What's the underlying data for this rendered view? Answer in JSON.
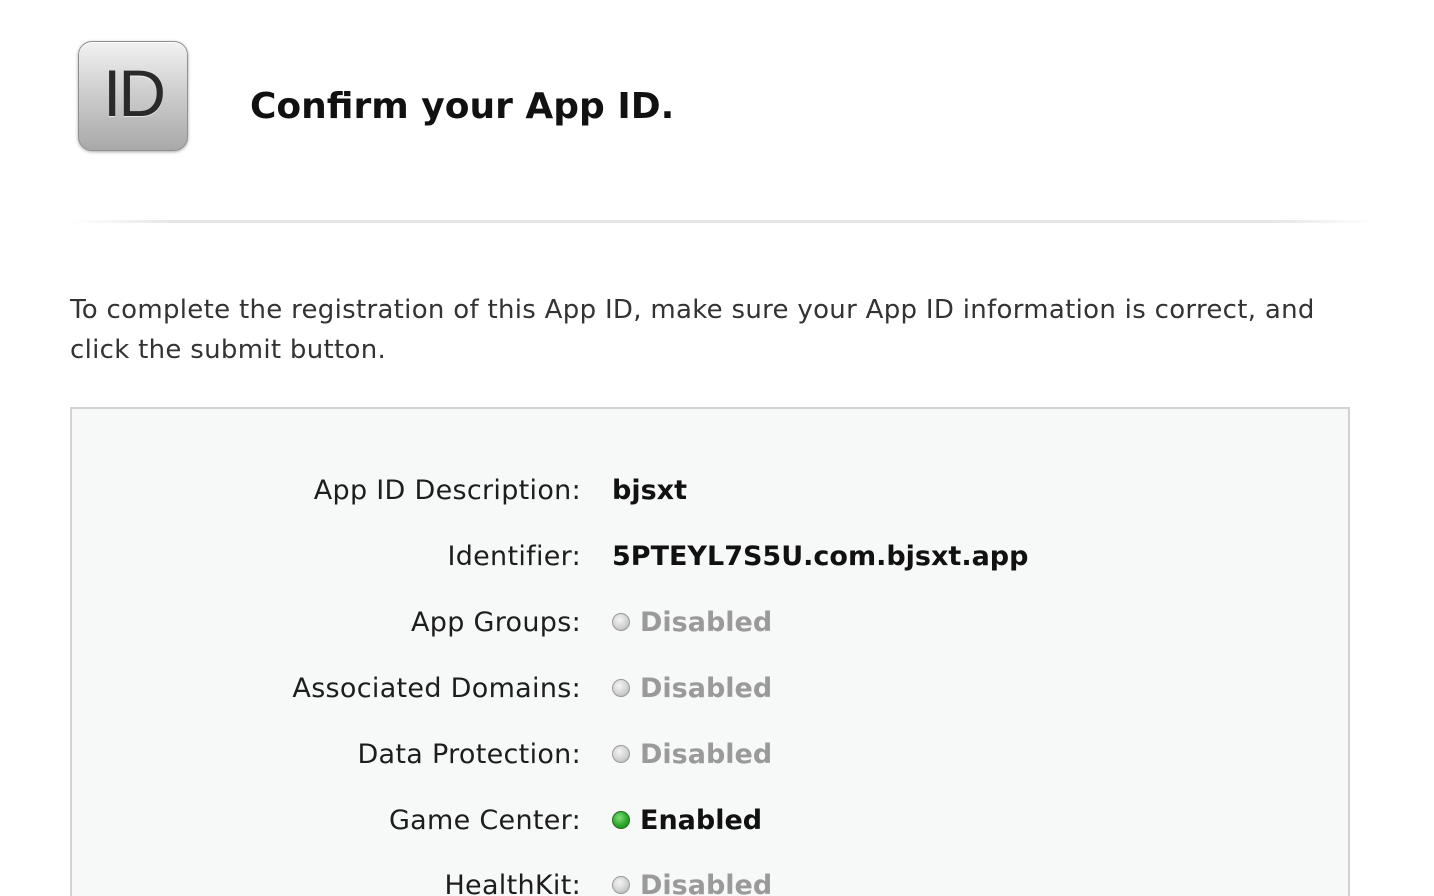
{
  "header": {
    "badge_text": "ID",
    "title": "Confirm your App ID."
  },
  "intro": "To complete the registration of this App ID, make sure your App ID information is correct, and click the submit button.",
  "details": {
    "description": {
      "label": "App ID Description:",
      "value": "bjsxt"
    },
    "identifier": {
      "label": "Identifier:",
      "value": "5PTEYL7S5U.com.bjsxt.app"
    },
    "services": [
      {
        "label": "App Groups:",
        "status": "Disabled"
      },
      {
        "label": "Associated Domains:",
        "status": "Disabled"
      },
      {
        "label": "Data Protection:",
        "status": "Disabled"
      },
      {
        "label": "Game Center:",
        "status": "Enabled"
      },
      {
        "label": "HealthKit:",
        "status": "Disabled"
      }
    ]
  },
  "colors": {
    "enabled_dot": "#2fa82b",
    "disabled_dot": "#cfcfcf",
    "disabled_text": "#9a9a9a"
  }
}
